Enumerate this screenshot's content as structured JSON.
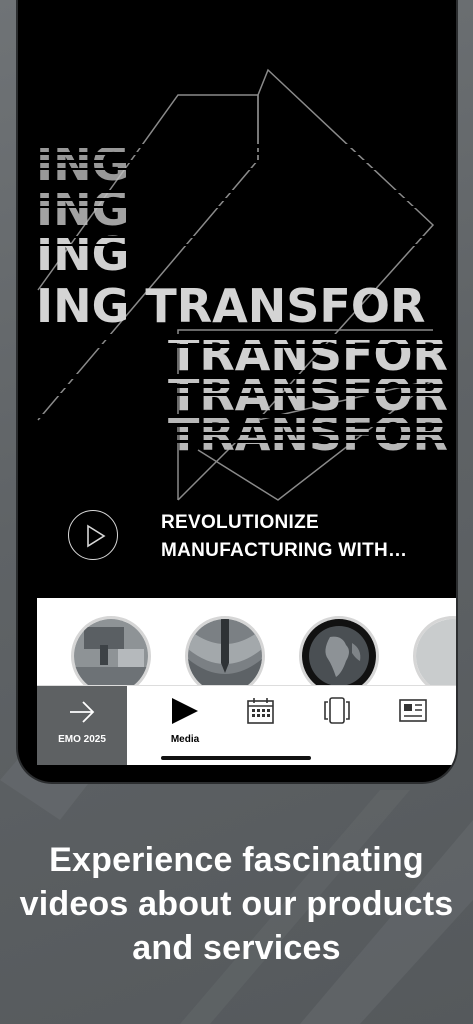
{
  "hero": {
    "title_line1": "REVOLUTIONIZE",
    "title_line2": "MANUFACTURING WITH…",
    "art_text_ing": "ING",
    "art_text_transform": "ING TRANSFOR",
    "art_text_ghost": "TRANSFOR"
  },
  "thumbnails": [
    {
      "name": "machine-thumbnail"
    },
    {
      "name": "tool-thumbnail"
    },
    {
      "name": "globe-thumbnail"
    },
    {
      "name": "partial-thumbnail"
    }
  ],
  "tabbar": {
    "event_label": "EMO 2025",
    "media_label": "Media",
    "icons": [
      "arrow-right-icon",
      "play-icon",
      "calendar-icon",
      "pages-icon",
      "news-icon"
    ]
  },
  "caption": {
    "line1": "Experience fascinating",
    "line2": "videos about our products",
    "line3": "and services"
  },
  "colors": {
    "background": "#5f6366",
    "event_tab": "#5e6163",
    "hero_bg": "#000000"
  }
}
